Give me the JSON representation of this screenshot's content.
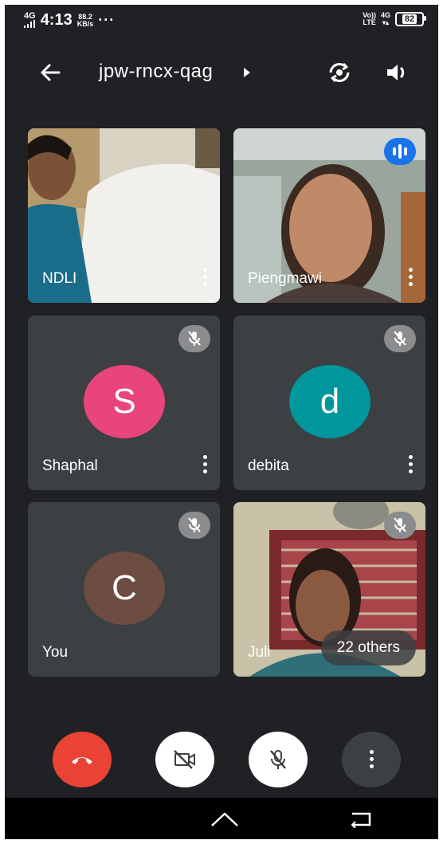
{
  "status_bar": {
    "network": "4G",
    "time": "4:13",
    "speed_value": "88.2",
    "speed_unit": "KB/s",
    "more": "···",
    "volte_top": "Vo))",
    "volte_bottom": "LTE",
    "data_type": "4G",
    "battery": "82"
  },
  "header": {
    "meeting_code": "jpw-rncx-qag",
    "icons": [
      "arrow-back-icon",
      "caret-right-icon",
      "switch-camera-icon",
      "speaker-icon"
    ]
  },
  "participants": [
    {
      "name": "NDLI",
      "video": true,
      "muted": false,
      "speaking": false
    },
    {
      "name": "Piengmawi",
      "video": true,
      "muted": false,
      "speaking": true
    },
    {
      "name": "Shaphal",
      "initial": "S",
      "avatar_color": "#e8457a",
      "muted": true
    },
    {
      "name": "debita",
      "initial": "d",
      "avatar_color": "#00979c",
      "muted": true
    },
    {
      "name": "You",
      "initial": "C",
      "avatar_color": "#6d4c41",
      "muted": true
    },
    {
      "name": "Juli",
      "video": true,
      "muted": true,
      "others_label": "22 others"
    }
  ],
  "controls": {
    "end_call_color": "#ea4335",
    "items": [
      "end-call-icon",
      "camera-off-icon",
      "mic-off-icon",
      "more-options-icon"
    ]
  },
  "colors": {
    "background": "#202124",
    "tile": "#3c4043",
    "speaking_indicator": "#1a73e8"
  }
}
